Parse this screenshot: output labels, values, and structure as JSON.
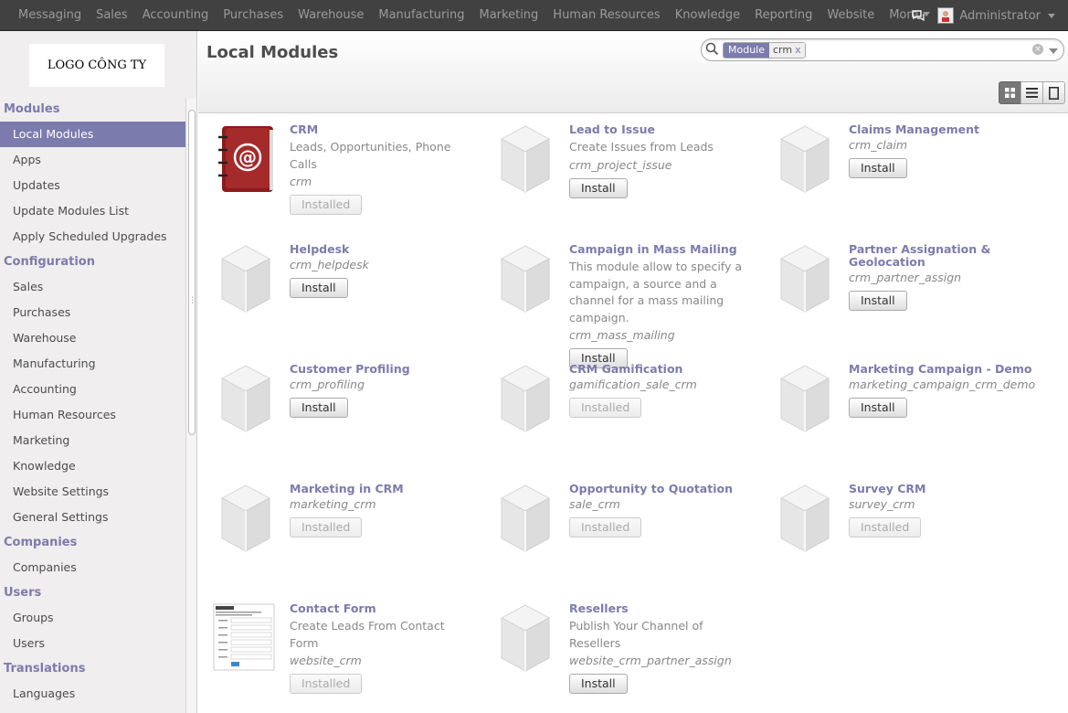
{
  "topbar": {
    "menu": [
      "Messaging",
      "Sales",
      "Accounting",
      "Purchases",
      "Warehouse",
      "Manufacturing",
      "Marketing",
      "Human Resources",
      "Knowledge",
      "Reporting",
      "Website",
      "More"
    ],
    "user": "Administrator",
    "icons": [
      "chat-icon",
      "caret-down-icon"
    ]
  },
  "sidebar": {
    "logo_text": "LOGO CÔNG TY",
    "sections": [
      {
        "title": "Modules",
        "items": [
          "Local Modules",
          "Apps",
          "Updates",
          "Update Modules List",
          "Apply Scheduled Upgrades"
        ]
      },
      {
        "title": "Configuration",
        "items": [
          "Sales",
          "Purchases",
          "Warehouse",
          "Manufacturing",
          "Accounting",
          "Human Resources",
          "Marketing",
          "Knowledge",
          "Website Settings",
          "General Settings"
        ]
      },
      {
        "title": "Companies",
        "items": [
          "Companies"
        ]
      },
      {
        "title": "Users",
        "items": [
          "Groups",
          "Users"
        ]
      },
      {
        "title": "Translations",
        "items": [
          "Languages"
        ]
      }
    ],
    "active_item": "Local Modules"
  },
  "header": {
    "title": "Local Modules",
    "search": {
      "facet_category": "Module",
      "facet_value": "crm",
      "facet_remove": "x"
    }
  },
  "labels": {
    "install": "Install",
    "installed": "Installed"
  },
  "modules": [
    {
      "name": "CRM",
      "summary": "Leads, Opportunities, Phone Calls",
      "tech": "crm",
      "state": "Installed",
      "icon": "address-book-icon"
    },
    {
      "name": "Lead to Issue",
      "summary": "Create Issues from Leads",
      "tech": "crm_project_issue",
      "state": "Install",
      "icon": "module-cube-icon"
    },
    {
      "name": "Claims Management",
      "summary": "",
      "tech": "crm_claim",
      "state": "Install",
      "icon": "module-cube-icon"
    },
    {
      "name": "Helpdesk",
      "summary": "",
      "tech": "crm_helpdesk",
      "state": "Install",
      "icon": "module-cube-icon"
    },
    {
      "name": "Campaign in Mass Mailing",
      "summary": "This module allow to specify a campaign, a source and a channel for a mass mailing campaign.",
      "tech": "crm_mass_mailing",
      "state": "Install",
      "icon": "module-cube-icon"
    },
    {
      "name": "Partner Assignation & Geolocation",
      "summary": "",
      "tech": "crm_partner_assign",
      "state": "Install",
      "icon": "module-cube-icon"
    },
    {
      "name": "Customer Profiling",
      "summary": "",
      "tech": "crm_profiling",
      "state": "Install",
      "icon": "module-cube-icon"
    },
    {
      "name": "CRM Gamification",
      "summary": "",
      "tech": "gamification_sale_crm",
      "state": "Installed",
      "icon": "module-cube-icon"
    },
    {
      "name": "Marketing Campaign - Demo",
      "summary": "",
      "tech": "marketing_campaign_crm_demo",
      "state": "Install",
      "icon": "module-cube-icon"
    },
    {
      "name": "Marketing in CRM",
      "summary": "",
      "tech": "marketing_crm",
      "state": "Installed",
      "icon": "module-cube-icon"
    },
    {
      "name": "Opportunity to Quotation",
      "summary": "",
      "tech": "sale_crm",
      "state": "Installed",
      "icon": "module-cube-icon"
    },
    {
      "name": "Survey CRM",
      "summary": "",
      "tech": "survey_crm",
      "state": "Installed",
      "icon": "module-cube-icon"
    },
    {
      "name": "Contact Form",
      "summary": "Create Leads From Contact Form",
      "tech": "website_crm",
      "state": "Installed",
      "icon": "contact-form-thumbnail-icon"
    },
    {
      "name": "Resellers",
      "summary": "Publish Your Channel of Resellers",
      "tech": "website_crm_partner_assign",
      "state": "Install",
      "icon": "module-cube-icon"
    }
  ],
  "colors": {
    "brand": "#7c7bad",
    "topbar": "#414141",
    "sidebar": "#f0eeee"
  }
}
